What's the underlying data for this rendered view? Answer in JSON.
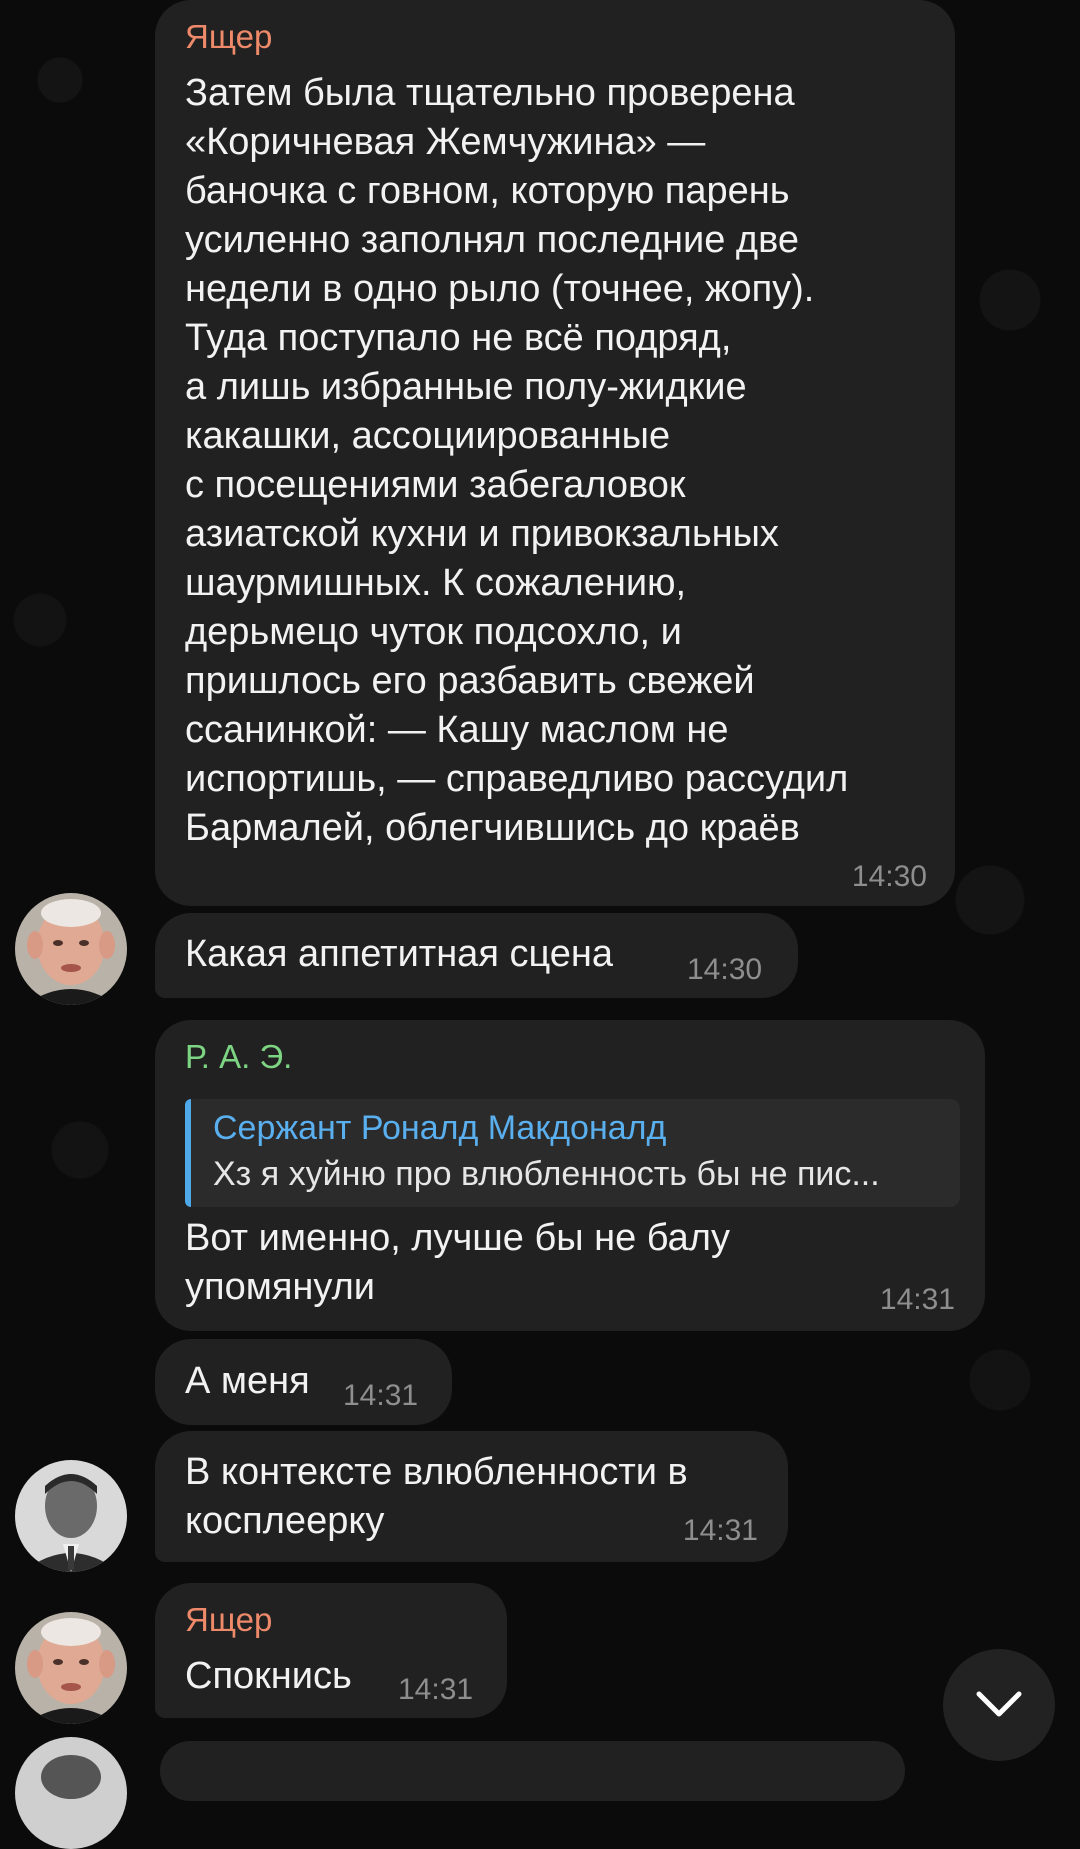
{
  "messages": [
    {
      "sender": "Ящер",
      "lines": [
        "Затем была тщательно проверена",
        "«Коричневая Жемчужина» —",
        "баночка с говном, которую парень",
        "усиленно заполнял последние две",
        "недели в одно рыло (точнее, жопу).",
        "Туда поступало не всё подряд,",
        "а лишь избранные полу-жидкие",
        "какашки, ассоциированные",
        "с посещениями забегаловок",
        "азиатской кухни и привокзальных",
        "шаурмишных. К сожалению,",
        "дерьмецо чуток подсохло, и",
        "пришлось его разбавить свежей",
        "ссанинкой:       — Кашу маслом не",
        "испортишь, — справедливо рассудил",
        "Бармалей, облегчившись до краёв"
      ],
      "time": "14:30"
    },
    {
      "text": "Какая аппетитная сцена",
      "time": "14:30"
    },
    {
      "sender": "Р. А. Э.",
      "reply": {
        "name": "Сержант Роналд Макдоналд",
        "text": "Хз я хуйню про влюбленность бы не пис..."
      },
      "lines": [
        "Вот именно, лучше бы не балу",
        "упомянули"
      ],
      "time": "14:31"
    },
    {
      "text": "А меня",
      "time": "14:31"
    },
    {
      "lines": [
        "В контексте влюбленности в",
        "косплеерку"
      ],
      "time": "14:31"
    },
    {
      "sender": "Ящер",
      "text": "Спокнись",
      "time": "14:31"
    }
  ],
  "colors": {
    "background": "#0b0b0b",
    "bubble": "#212121",
    "sender_orange": "#ee8a6a",
    "sender_green": "#7dd583",
    "reply_accent": "#4fa8e8",
    "timestamp": "#8e8e8e"
  },
  "icons": {
    "scroll_down": "chevron-down-icon"
  }
}
